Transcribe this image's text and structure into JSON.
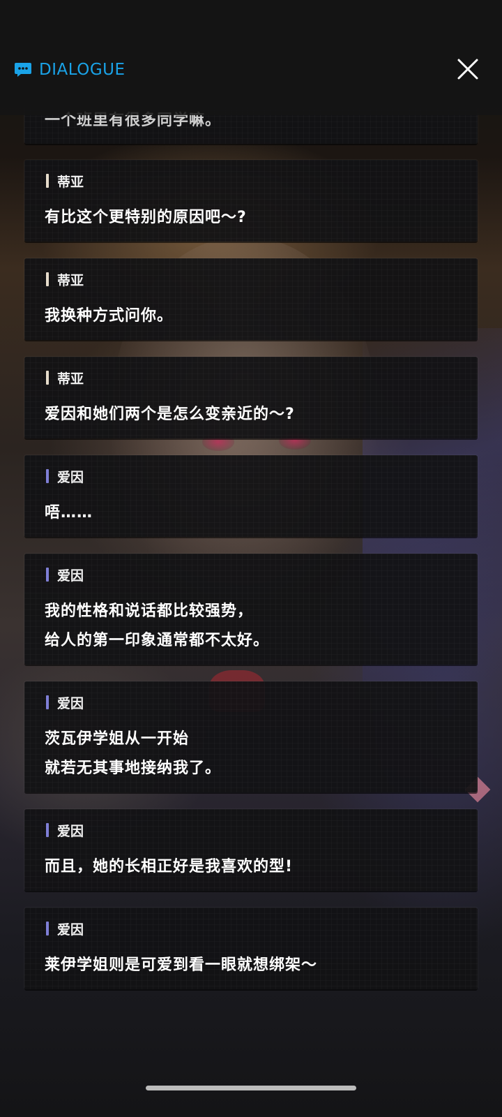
{
  "header": {
    "title": "DIALOGUE",
    "icon": "chat-bubble-icon",
    "accent_color": "#1aa3e8"
  },
  "close_icon": "close-icon",
  "speaker_colors": {
    "蒂亚": "#e6dccb",
    "爱因": "#7f7fd6"
  },
  "entries": [
    {
      "speaker": "",
      "lines": [
        "一个班里有很多同学嘛。"
      ],
      "partial": true
    },
    {
      "speaker": "蒂亚",
      "lines": [
        "有比这个更特别的原因吧～?"
      ]
    },
    {
      "speaker": "蒂亚",
      "lines": [
        "我换种方式问你。"
      ]
    },
    {
      "speaker": "蒂亚",
      "lines": [
        "爱因和她们两个是怎么变亲近的～?"
      ]
    },
    {
      "speaker": "爱因",
      "lines": [
        "唔……"
      ]
    },
    {
      "speaker": "爱因",
      "lines": [
        "我的性格和说话都比较强势，",
        "给人的第一印象通常都不太好。"
      ]
    },
    {
      "speaker": "爱因",
      "lines": [
        "茨瓦伊学姐从一开始",
        "就若无其事地接纳我了。"
      ]
    },
    {
      "speaker": "爱因",
      "lines": [
        "而且，她的长相正好是我喜欢的型!"
      ]
    },
    {
      "speaker": "爱因",
      "lines": [
        "莱伊学姐则是可爱到看一眼就想绑架～"
      ]
    }
  ]
}
